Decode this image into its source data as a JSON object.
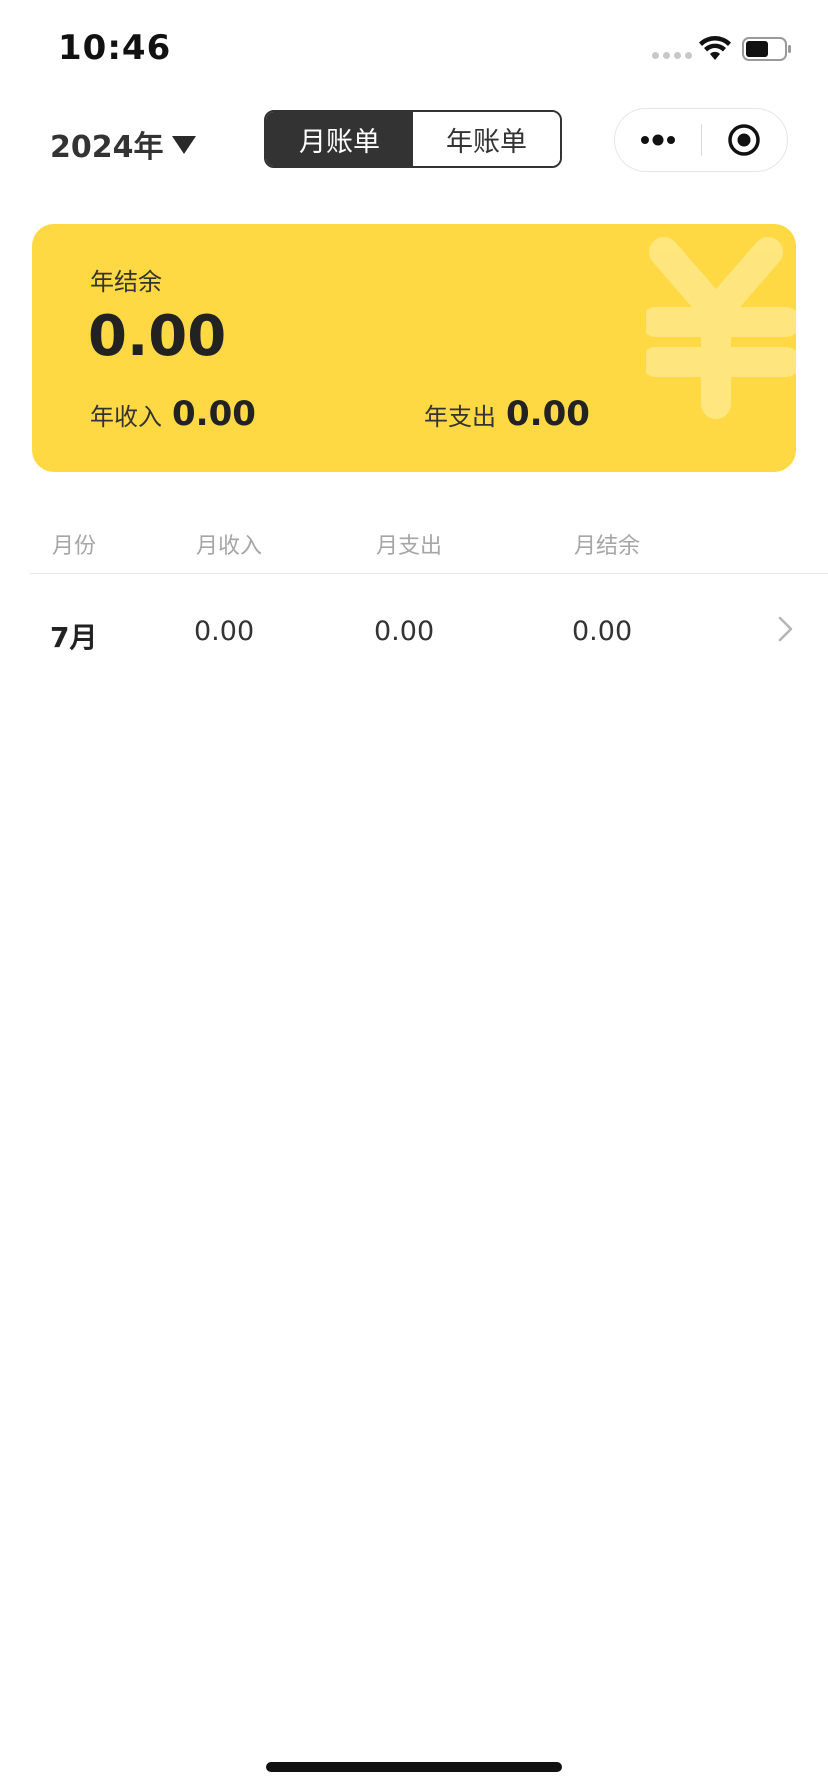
{
  "status_bar": {
    "time": "10:46"
  },
  "header": {
    "year_label": "2024年",
    "tabs": [
      {
        "label": "月账单",
        "active": true
      },
      {
        "label": "年账单",
        "active": false
      }
    ]
  },
  "summary": {
    "balance_label": "年结余",
    "balance_value": "0.00",
    "income_label": "年收入",
    "income_value": "0.00",
    "expense_label": "年支出",
    "expense_value": "0.00",
    "card_color": "#fed943"
  },
  "table": {
    "columns": [
      "月份",
      "月收入",
      "月支出",
      "月结余"
    ],
    "rows": [
      {
        "month": "7月",
        "income": "0.00",
        "expense": "0.00",
        "balance": "0.00"
      }
    ]
  },
  "icons": {
    "year_dropdown": "triangle-down-icon",
    "capsule_more": "more-dots-icon",
    "capsule_close": "target-circle-icon",
    "card_watermark": "yen-icon",
    "row_arrow": "chevron-right-icon"
  },
  "colors": {
    "accent_dark": "#333333",
    "card_yellow": "#fed943",
    "muted_text": "#a6a6a6"
  }
}
